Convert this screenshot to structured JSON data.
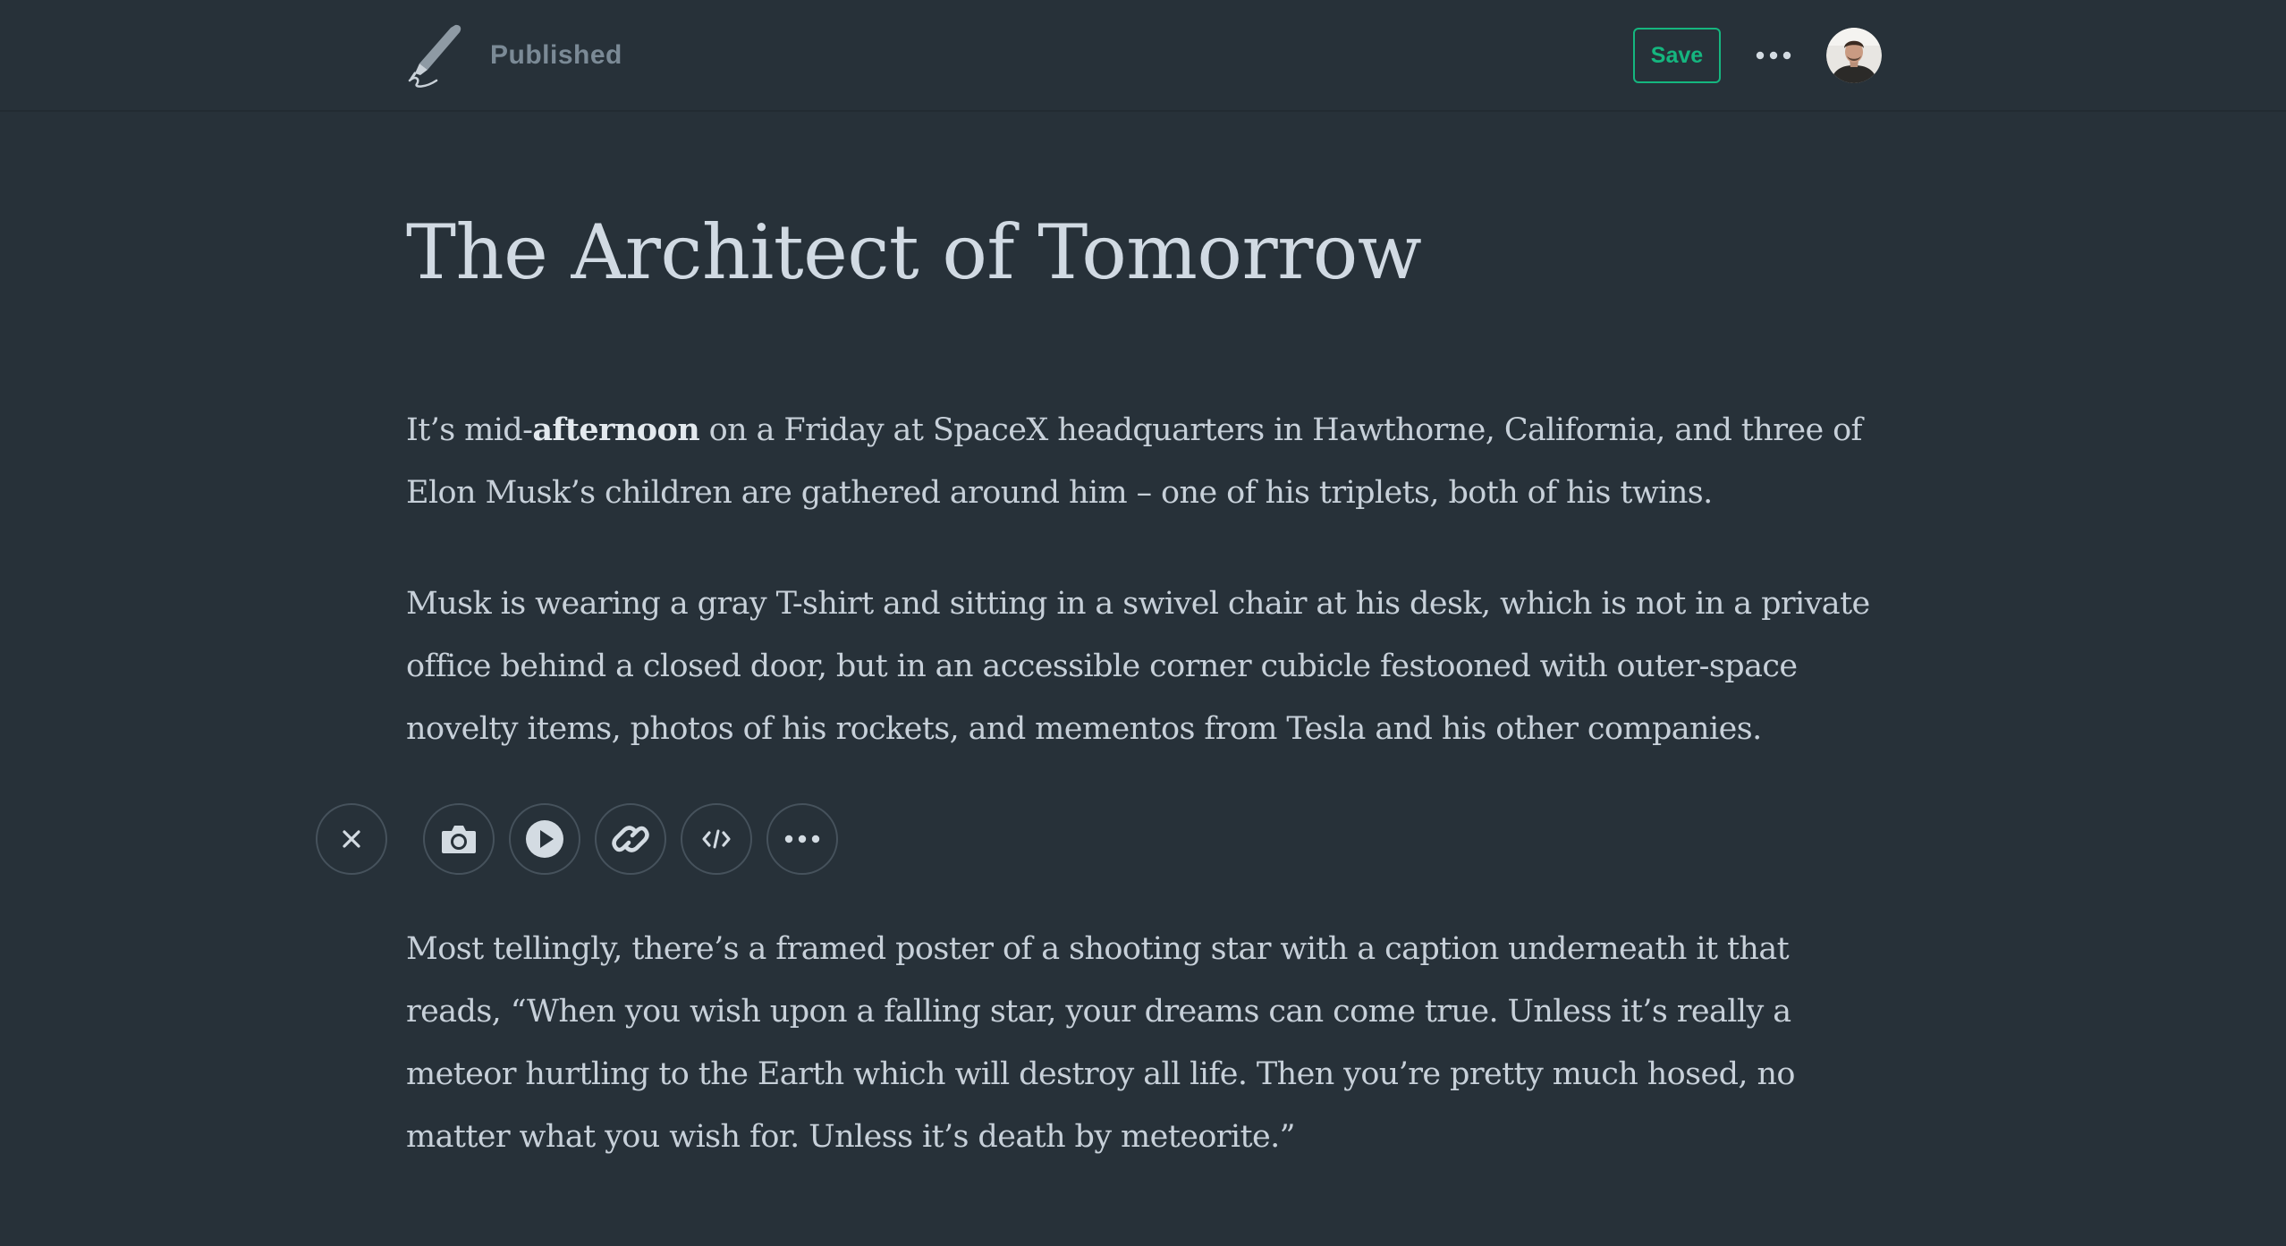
{
  "header": {
    "logo_icon": "quill-pen-icon",
    "status": "Published",
    "save_label": "Save",
    "more_icon": "ellipsis-icon",
    "avatar_icon": "user-avatar"
  },
  "colors": {
    "background": "#273139",
    "accent": "#15b67f",
    "body_text": "#c7d0d9",
    "muted": "#7b8a96"
  },
  "article": {
    "title": "The Architect of Tomorrow",
    "paragraphs": [
      {
        "lines": [
          {
            "before": "It’s mid-",
            "bold": "afternoon",
            "after": " on a Friday at SpaceX headquarters in Hawthorne, California, and three of"
          },
          "Elon Musk’s children are gathered around him – one of his triplets, both of his twins."
        ]
      },
      {
        "lines": [
          "Musk is wearing a gray T-shirt and sitting in a swivel chair at his desk, which is not in a private",
          "office behind a closed door, but in an accessible corner cubicle festooned with outer-space",
          "novelty items, photos of his rockets, and mementos from Tesla and his other companies."
        ]
      },
      {
        "lines": [
          "Most tellingly, there’s a framed poster of a shooting star with a caption underneath it that",
          "reads, “When you wish upon a falling star, your dreams can come true. Unless it’s really a",
          "meteor hurtling to the Earth which will destroy all life. Then you’re pretty much hosed, no",
          "matter what you wish for. Unless it’s death by meteorite.”"
        ]
      }
    ]
  },
  "insert_toolbar": {
    "buttons": [
      {
        "name": "close-insert",
        "icon": "close-icon"
      },
      {
        "name": "insert-image",
        "icon": "camera-icon"
      },
      {
        "name": "insert-video",
        "icon": "play-icon"
      },
      {
        "name": "insert-embed",
        "icon": "link-icon"
      },
      {
        "name": "insert-code",
        "icon": "code-icon"
      },
      {
        "name": "insert-more",
        "icon": "ellipsis-icon"
      }
    ]
  }
}
